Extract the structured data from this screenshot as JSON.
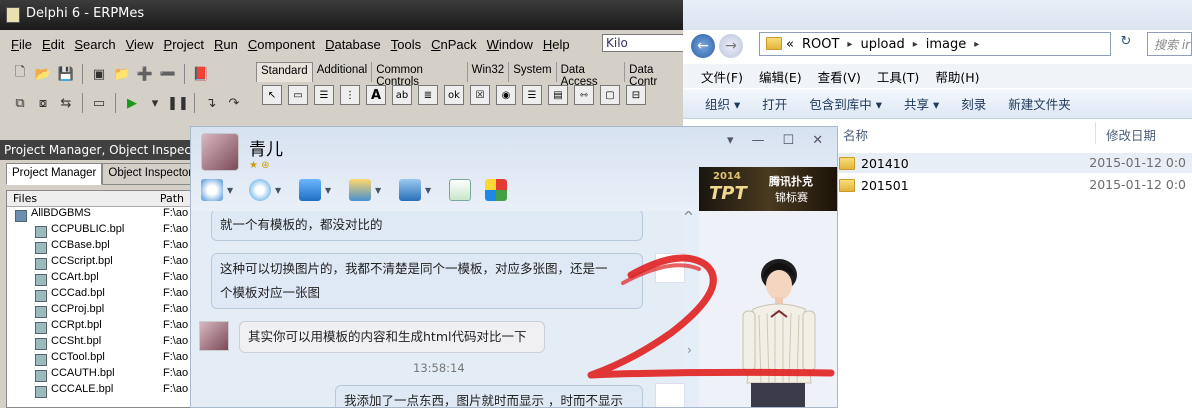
{
  "delphi": {
    "title": "Delphi 6 - ERPMes",
    "menu": [
      "File",
      "Edit",
      "Search",
      "View",
      "Project",
      "Run",
      "Component",
      "Database",
      "Tools",
      "CnPack",
      "Window",
      "Help"
    ],
    "search_value": "Kilo",
    "palette_tabs": [
      "Standard",
      "Additional",
      "Common Controls",
      "Win32",
      "System",
      "Data Access",
      "Data Contr"
    ],
    "project_manager": {
      "title": "Project Manager, Object Inspect",
      "tabs": [
        "Project Manager",
        "Object Inspector"
      ],
      "columns": [
        "Files",
        "Path"
      ],
      "root": {
        "name": "AllBDGBMS",
        "path": "F:\\ao"
      },
      "items": [
        {
          "name": "CCPUBLIC.bpl",
          "path": "F:\\ao"
        },
        {
          "name": "CCBase.bpl",
          "path": "F:\\ao"
        },
        {
          "name": "CCScript.bpl",
          "path": "F:\\ao"
        },
        {
          "name": "CCArt.bpl",
          "path": "F:\\ao"
        },
        {
          "name": "CCCad.bpl",
          "path": "F:\\ao"
        },
        {
          "name": "CCProj.bpl",
          "path": "F:\\ao"
        },
        {
          "name": "CCRpt.bpl",
          "path": "F:\\ao"
        },
        {
          "name": "CCSht.bpl",
          "path": "F:\\ao"
        },
        {
          "name": "CCTool.bpl",
          "path": "F:\\ao"
        },
        {
          "name": "CCAUTH.bpl",
          "path": "F:\\ao"
        },
        {
          "name": "CCCALE.bpl",
          "path": "F:\\ao"
        }
      ]
    }
  },
  "explorer": {
    "breadcrumb": [
      "«",
      "ROOT",
      "upload",
      "image"
    ],
    "search_placeholder": "搜索 ir",
    "menu": [
      "文件(F)",
      "编辑(E)",
      "查看(V)",
      "工具(T)",
      "帮助(H)"
    ],
    "commands": [
      "组织 ▾",
      "打开",
      "包含到库中 ▾",
      "共享 ▾",
      "刻录",
      "新建文件夹"
    ],
    "columns": [
      "名称",
      "修改日期"
    ],
    "files": [
      {
        "name": "201410",
        "date": "2015-01-12 0:0"
      },
      {
        "name": "201501",
        "date": "2015-01-12 0:0"
      }
    ]
  },
  "qq": {
    "contact_name": "青儿",
    "ad": {
      "year": "2014",
      "brand": "TPT",
      "line1": "腾讯扑克",
      "line2": "锦标赛"
    },
    "messages": [
      {
        "text": "就一个有模板的，都没对比的",
        "dir": "out"
      },
      {
        "text1": "这种可以切换图片的，我都不清楚是同个一模板，对应多张图，还是一",
        "text2": "个模板对应一张图",
        "dir": "out"
      },
      {
        "text": "其实你可以用模板的内容和生成html代码对比一下",
        "dir": "in"
      },
      {
        "text": "我添加了一点东西，图片就时而显示 ，时而不显示",
        "dir": "out"
      }
    ],
    "timestamp": "13:58:14"
  },
  "colors": {
    "accent_red": "#e02020",
    "qq_bubble": "#dfe9f5"
  }
}
